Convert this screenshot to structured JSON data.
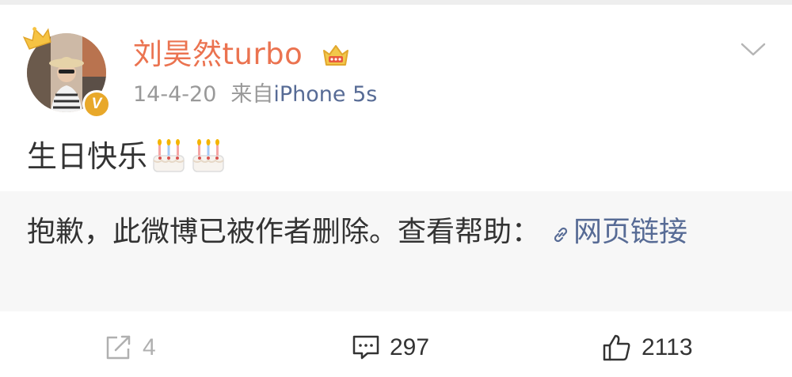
{
  "post": {
    "username": "刘昊然turbo",
    "date": "14-4-20",
    "source_prefix": "来自",
    "device": "iPhone 5s",
    "text": "生日快乐",
    "emojis": [
      "cake-icon",
      "cake-icon"
    ]
  },
  "retweet": {
    "deleted_message": "抱歉，此微博已被作者删除。查看帮助：",
    "help_link_label": "网页链接"
  },
  "actions": {
    "repost_count": "4",
    "comment_count": "297",
    "like_count": "2113"
  },
  "colors": {
    "username": "#eb7350",
    "link": "#576b95",
    "meta": "#999999",
    "badge": "#e8a82a"
  }
}
